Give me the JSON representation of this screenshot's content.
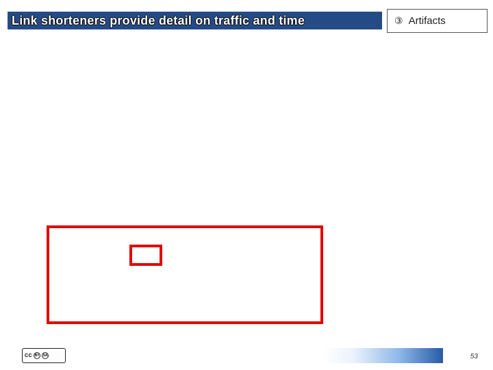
{
  "header": {
    "title": "Link shorteners provide detail on traffic and time"
  },
  "badge": {
    "number_glyph": "③",
    "label": "Artifacts"
  },
  "annotations": {
    "outer_box": "highlight-region",
    "inner_box": "highlight-subregion"
  },
  "footer": {
    "license": {
      "cc": "CC",
      "by": "BY",
      "sa": "SA"
    },
    "page_number": "53"
  }
}
